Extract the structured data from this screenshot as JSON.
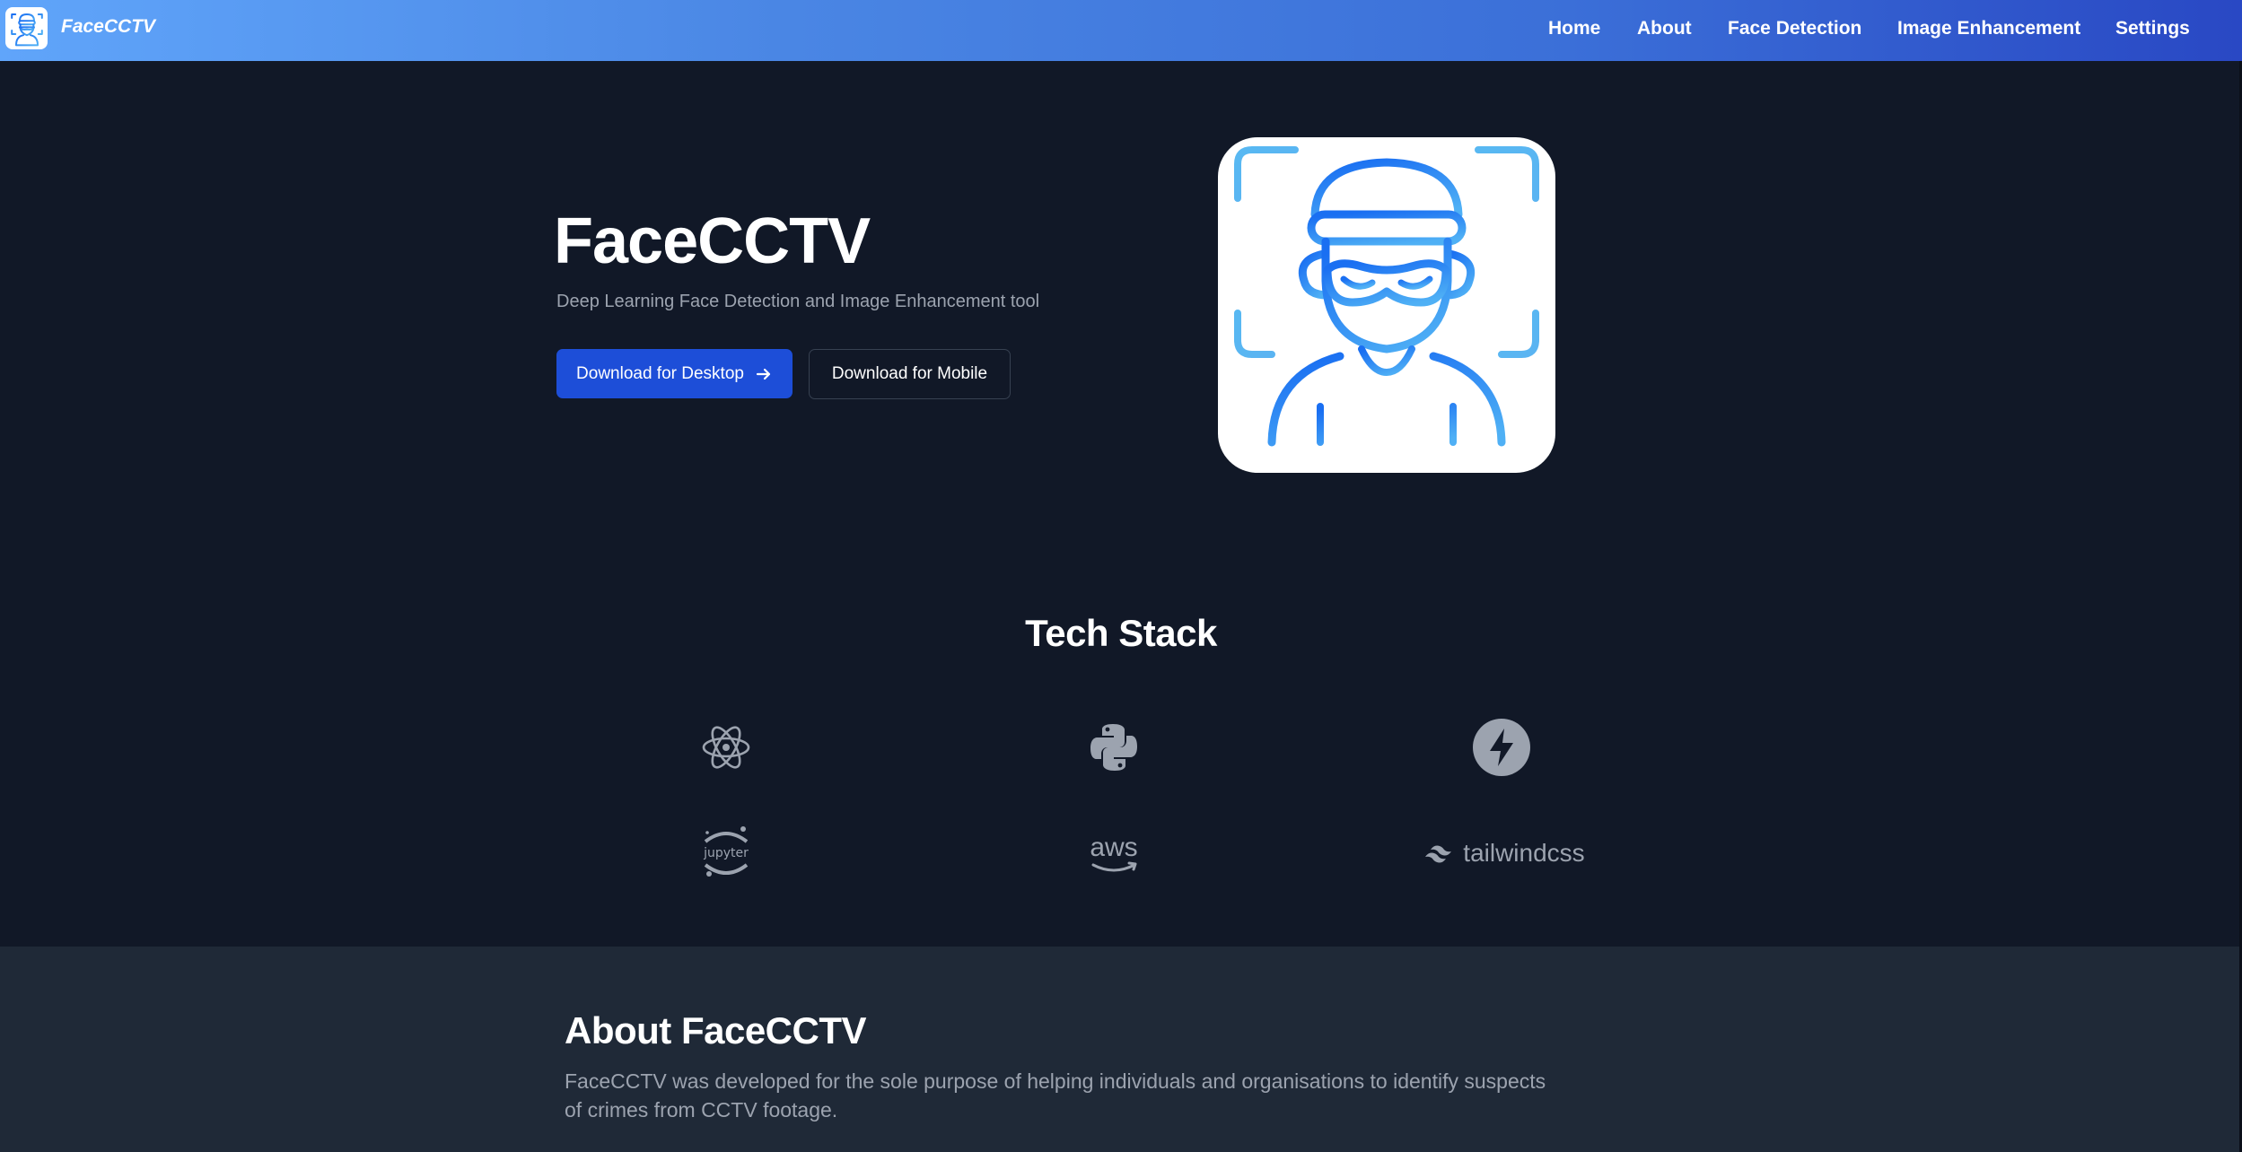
{
  "navbar": {
    "brand": "FaceCCTV",
    "links": [
      "Home",
      "About",
      "Face Detection",
      "Image Enhancement",
      "Settings"
    ]
  },
  "hero": {
    "title": "FaceCCTV",
    "subtitle": "Deep Learning Face Detection and Image Enhancement tool",
    "primary_button": "Download for Desktop",
    "secondary_button": "Download for Mobile"
  },
  "tech_stack": {
    "title": "Tech Stack",
    "logos": [
      "electron-logo-icon",
      "python-logo-icon",
      "fastapi-logo-icon",
      "jupyter-logo-icon",
      "aws-logo-icon",
      "tailwindcss-logo-icon"
    ],
    "jupyter_text": "jupyter",
    "aws_text": "aws",
    "tailwind_text": "tailwindcss"
  },
  "about": {
    "title": "About FaceCCTV",
    "text": "FaceCCTV was developed for the sole purpose of helping individuals and organisations to identify suspects of crimes from CCTV footage."
  },
  "colors": {
    "background": "#111827",
    "about_background": "#1f2937",
    "primary": "#1d4ed8",
    "nav_gradient_start": "#60a5fa",
    "nav_gradient_end": "#2948c4",
    "muted_text": "#9ca3af"
  }
}
